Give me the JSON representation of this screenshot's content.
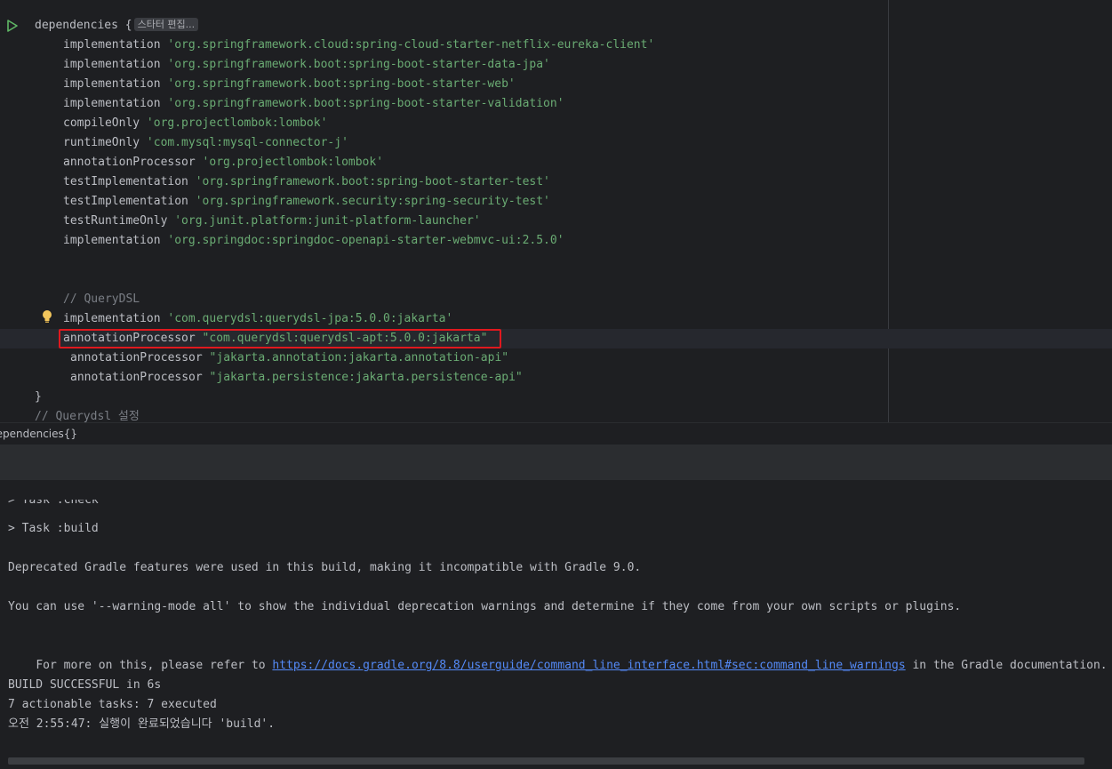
{
  "editor": {
    "inlay_hint": "스타터 편집...",
    "lines": [
      {
        "keyword": "dependencies {",
        "value": "",
        "comment": ""
      },
      {
        "keyword": "implementation ",
        "value": "'org.springframework.cloud:spring-cloud-starter-netflix-eureka-client'",
        "comment": ""
      },
      {
        "keyword": "implementation ",
        "value": "'org.springframework.boot:spring-boot-starter-data-jpa'",
        "comment": ""
      },
      {
        "keyword": "implementation ",
        "value": "'org.springframework.boot:spring-boot-starter-web'",
        "comment": ""
      },
      {
        "keyword": "implementation ",
        "value": "'org.springframework.boot:spring-boot-starter-validation'",
        "comment": ""
      },
      {
        "keyword": "compileOnly ",
        "value": "'org.projectlombok:lombok'",
        "comment": ""
      },
      {
        "keyword": "runtimeOnly ",
        "value": "'com.mysql:mysql-connector-j'",
        "comment": ""
      },
      {
        "keyword": "annotationProcessor ",
        "value": "'org.projectlombok:lombok'",
        "comment": ""
      },
      {
        "keyword": "testImplementation ",
        "value": "'org.springframework.boot:spring-boot-starter-test'",
        "comment": ""
      },
      {
        "keyword": "testImplementation ",
        "value": "'org.springframework.security:spring-security-test'",
        "comment": ""
      },
      {
        "keyword": "testRuntimeOnly ",
        "value": "'org.junit.platform:junit-platform-launcher'",
        "comment": ""
      },
      {
        "keyword": "implementation ",
        "value": "'org.springdoc:springdoc-openapi-starter-webmvc-ui:2.5.0'",
        "comment": ""
      },
      {
        "keyword": "",
        "value": "",
        "comment": ""
      },
      {
        "keyword": "",
        "value": "",
        "comment": ""
      },
      {
        "keyword": "",
        "value": "",
        "comment": "// QueryDSL"
      },
      {
        "keyword": "implementation ",
        "value": "'com.querydsl:querydsl-jpa:5.0.0:jakarta'",
        "comment": ""
      },
      {
        "keyword": "annotationProcessor ",
        "value": "\"com.querydsl:querydsl-apt:5.0.0:jakarta\"",
        "comment": ""
      },
      {
        "keyword": "annotationProcessor ",
        "value": "\"jakarta.annotation:jakarta.annotation-api\"",
        "comment": ""
      },
      {
        "keyword": "annotationProcessor ",
        "value": "\"jakarta.persistence:jakarta.persistence-api\"",
        "comment": ""
      },
      {
        "keyword": "}",
        "value": "",
        "comment": ""
      },
      {
        "keyword": "",
        "value": "",
        "comment": "// Querydsl 설정"
      }
    ]
  },
  "breadcrumb": {
    "text": "dependencies{}"
  },
  "console": {
    "partial_top": "> Task :check",
    "task_build": "> Task :build",
    "deprecated": "Deprecated Gradle features were used in this build, making it incompatible with Gradle 9.0.",
    "warning_mode": "You can use '--warning-mode all' to show the individual deprecation warnings and determine if they come from your own scripts or plugins.",
    "refer_prefix": "For more on this, please refer to ",
    "refer_link": "https://docs.gradle.org/8.8/userguide/command_line_interface.html#sec:command_line_warnings",
    "refer_suffix": " in the Gradle documentation.",
    "build_status": "BUILD SUCCESSFUL in 6s",
    "tasks_summary": "7 actionable tasks: 7 executed",
    "finished": "오전 2:55:47: 실행이 완료되었습니다 'build'."
  },
  "colors": {
    "highlight_border": "#e0181e",
    "string": "#6aab73",
    "comment": "#7a7e85",
    "link": "#548af7",
    "run_icon": "#5fb865",
    "bulb_icon": "#f2c55c"
  }
}
